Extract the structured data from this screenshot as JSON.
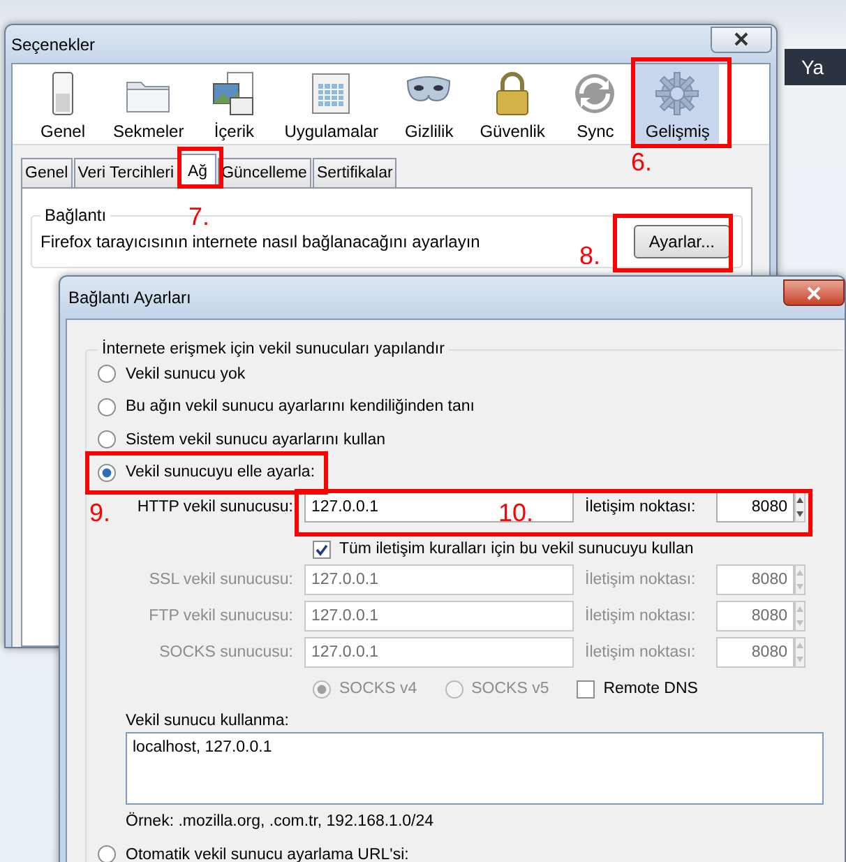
{
  "browser": {
    "tab_text": "Ya"
  },
  "options_window": {
    "title": "Seçenekler",
    "toolbar": [
      {
        "label": "Genel",
        "selected": false
      },
      {
        "label": "Sekmeler",
        "selected": false
      },
      {
        "label": "İçerik",
        "selected": false
      },
      {
        "label": "Uygulamalar",
        "selected": false
      },
      {
        "label": "Gizlilik",
        "selected": false
      },
      {
        "label": "Güvenlik",
        "selected": false
      },
      {
        "label": "Sync",
        "selected": false
      },
      {
        "label": "Gelişmiş",
        "selected": true
      }
    ],
    "tabs": [
      {
        "label": "Genel",
        "selected": false
      },
      {
        "label": "Veri Tercihleri",
        "selected": false
      },
      {
        "label": "Ağ",
        "selected": true
      },
      {
        "label": "Güncelleme",
        "selected": false
      },
      {
        "label": "Sertifikalar",
        "selected": false
      }
    ],
    "connection_group": {
      "title": "Bağlantı",
      "description": "Firefox tarayıcısının internete nasıl bağlanacağını ayarlayın",
      "button": "Ayarlar..."
    }
  },
  "connection_dialog": {
    "title": "Bağlantı Ayarları",
    "group_title": "İnternete erişmek için vekil sunucuları yapılandır",
    "proxy_options": [
      {
        "label": "Vekil sunucu yok",
        "selected": false
      },
      {
        "label": "Bu ağın vekil sunucu ayarlarını kendiliğinden tanı",
        "selected": false
      },
      {
        "label": "Sistem vekil sunucu ayarlarını kullan",
        "selected": false
      },
      {
        "label": "Vekil sunucuyu elle ayarla:",
        "selected": true
      }
    ],
    "proxies": [
      {
        "label": "HTTP vekil sunucusu:",
        "host": "127.0.0.1",
        "port_label": "İletişim noktası:",
        "port": "8080",
        "disabled": false
      },
      {
        "label": "SSL vekil sunucusu:",
        "host": "127.0.0.1",
        "port_label": "İletişim noktası:",
        "port": "8080",
        "disabled": true
      },
      {
        "label": "FTP vekil sunucusu:",
        "host": "127.0.0.1",
        "port_label": "İletişim noktası:",
        "port": "8080",
        "disabled": true
      },
      {
        "label": "SOCKS sunucusu:",
        "host": "127.0.0.1",
        "port_label": "İletişim noktası:",
        "port": "8080",
        "disabled": true
      }
    ],
    "share_all": {
      "label": "Tüm iletişim kuralları için bu vekil sunucuyu kullan",
      "checked": true
    },
    "socks_versions": [
      {
        "label": "SOCKS v4",
        "selected": true,
        "disabled": true
      },
      {
        "label": "SOCKS v5",
        "selected": false,
        "disabled": true
      }
    ],
    "remote_dns": {
      "label": "Remote DNS",
      "checked": false
    },
    "no_proxy_label": "Vekil sunucu kullanma:",
    "no_proxy_value": "localhost, 127.0.0.1",
    "example": "Örnek: .mozilla.org, .com.tr, 192.168.1.0/24",
    "auto_option": {
      "label": "Otomatik vekil sunucu ayarlama URL'si:",
      "selected": false
    }
  },
  "annotations": [
    {
      "number": "6."
    },
    {
      "number": "7."
    },
    {
      "number": "8."
    },
    {
      "number": "9."
    },
    {
      "number": "10."
    }
  ]
}
